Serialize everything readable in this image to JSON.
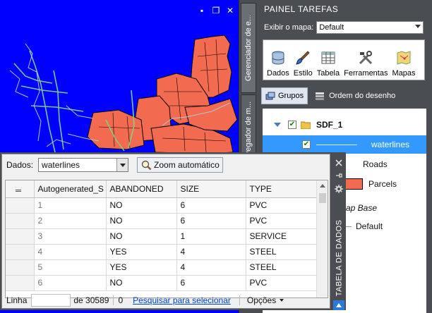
{
  "window": {
    "minimize": "▪",
    "restore": "❐",
    "close": "✕"
  },
  "side_tabs": {
    "manager": "Gerenciador de e...",
    "navigator": "vegador de m..."
  },
  "panel": {
    "title": "PAINEL TAREFAS",
    "map_label": "Exibir o mapa:",
    "map_value": "Default",
    "tools": [
      {
        "label": "Dados",
        "icon": "database-icon"
      },
      {
        "label": "Estilo",
        "icon": "paintbrush-icon"
      },
      {
        "label": "Tabela",
        "icon": "table-icon"
      },
      {
        "label": "Ferramentas",
        "icon": "tools-icon"
      },
      {
        "label": "Mapas",
        "icon": "maps-icon"
      }
    ],
    "groups_label": "Grupos",
    "draw_order_label": "Ordem do desenho",
    "tree": {
      "root": "SDF_1",
      "layers": [
        "waterlines",
        "Roads",
        "Parcels"
      ],
      "base_partial": "ap Base",
      "base_child": "Default"
    }
  },
  "dialog": {
    "source_label": "Dados:",
    "source_value": "waterlines",
    "zoom_label": "Zoom automático",
    "columns": [
      "Autogenerated_S",
      "ABANDONED",
      "SIZE",
      "TYPE"
    ],
    "rows": [
      [
        "1",
        "NO",
        "6",
        "PVC"
      ],
      [
        "2",
        "NO",
        "6",
        "PVC"
      ],
      [
        "3",
        "NO",
        "1",
        "SERVICE"
      ],
      [
        "4",
        "YES",
        "4",
        "STEEL"
      ],
      [
        "5",
        "YES",
        "4",
        "STEEL"
      ],
      [
        "6",
        "NO",
        "6",
        "PVC"
      ]
    ],
    "status": {
      "row_label": "Linha",
      "of_total": "de 30589",
      "selected": "0",
      "search_link": "Pesquisar para selecionar",
      "options": "Opções"
    },
    "side_title": "TABELA DE DADOS"
  },
  "colors": {
    "map_bg": "#0000ff",
    "parcel_fill": "#f26b50",
    "selection": "#3399ff",
    "panel_bg": "#4a4d52"
  }
}
